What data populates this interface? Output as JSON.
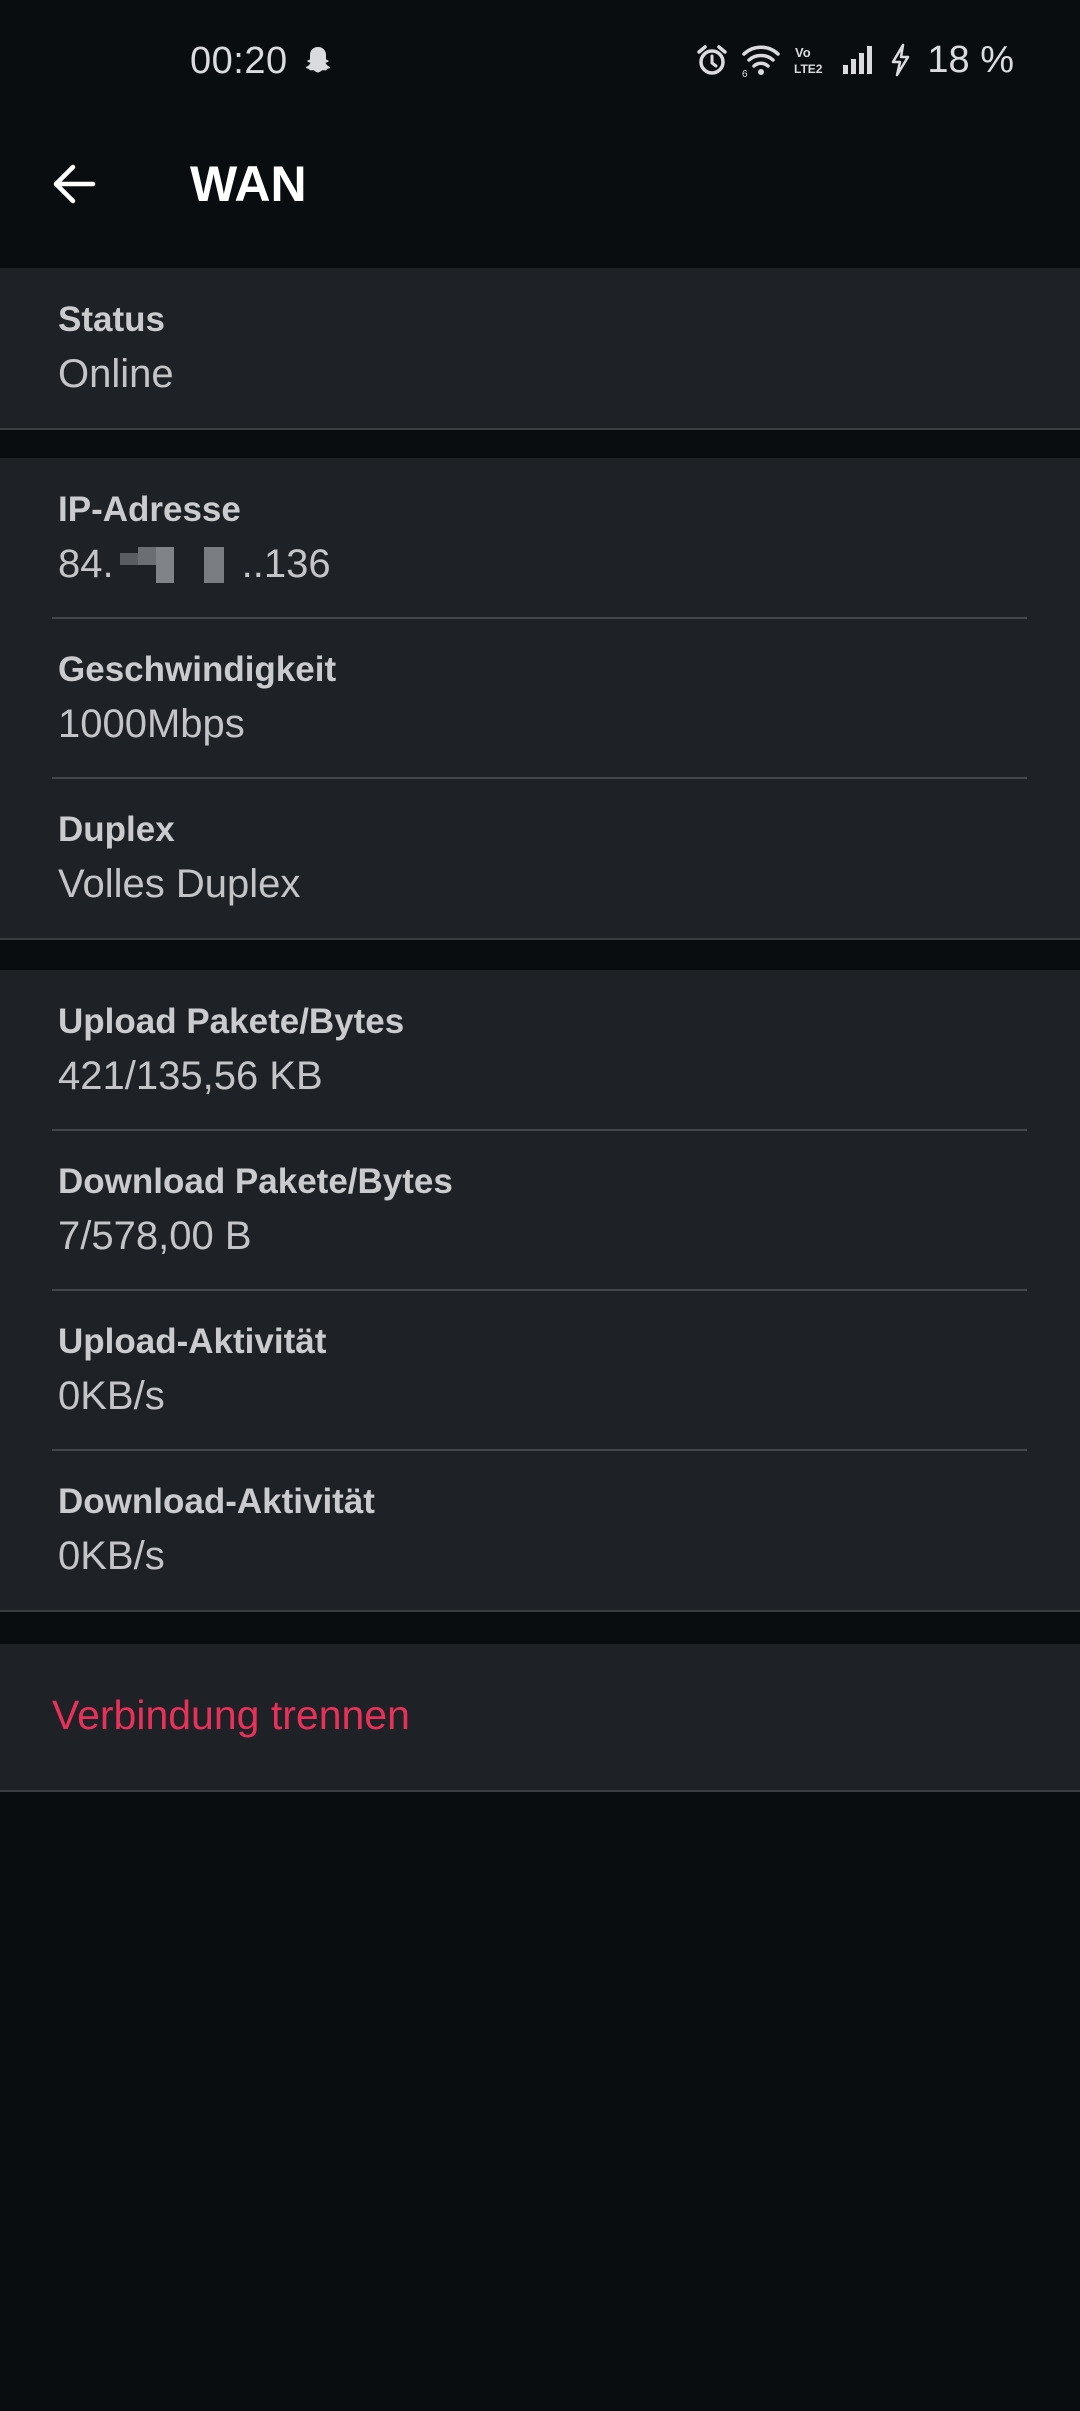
{
  "status_bar": {
    "time": "00:20",
    "battery": "18 %",
    "icons": [
      "snapchat-icon",
      "alarm-icon",
      "wifi-icon",
      "volte-icon",
      "signal-icon",
      "charging-icon"
    ]
  },
  "toolbar": {
    "title": "WAN",
    "back_icon": "arrow-left-icon"
  },
  "sections": {
    "status": {
      "label": "Status",
      "value": "Online"
    },
    "connection": {
      "ip_label": "IP-Adresse",
      "ip_prefix": "84.",
      "ip_suffix": "..136",
      "speed_label": "Geschwindigkeit",
      "speed_value": "1000Mbps",
      "duplex_label": "Duplex",
      "duplex_value": "Volles Duplex"
    },
    "traffic": {
      "upload_packets_label": "Upload Pakete/Bytes",
      "upload_packets_value": "421/135,56 KB",
      "download_packets_label": "Download Pakete/Bytes",
      "download_packets_value": "7/578,00 B",
      "upload_activity_label": "Upload-Aktivität",
      "upload_activity_value": "0KB/s",
      "download_activity_label": "Download-Aktivität",
      "download_activity_value": "0KB/s"
    }
  },
  "actions": {
    "disconnect_label": "Verbindung trennen"
  },
  "colors": {
    "background": "#0a0d10",
    "card": "#1e2125",
    "danger": "#e8315a",
    "title": "#ffffff"
  }
}
